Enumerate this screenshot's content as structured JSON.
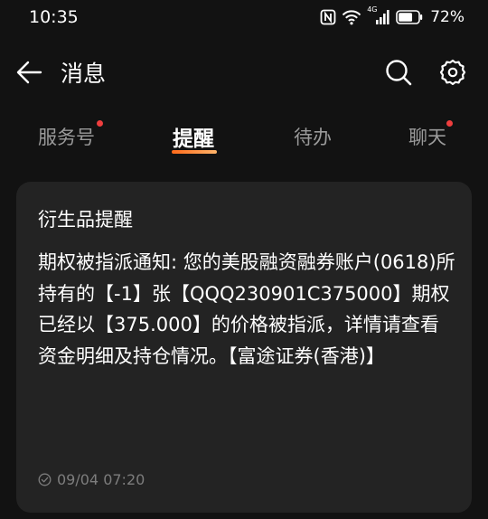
{
  "status_bar": {
    "time": "10:35",
    "network_label": "4G",
    "battery": "72%",
    "battery_level": 0.72
  },
  "header": {
    "title": "消息",
    "back_icon": "arrow-left-icon",
    "search_icon": "search-icon",
    "settings_icon": "gear-icon"
  },
  "tabs": [
    {
      "label": "服务号",
      "badge": true,
      "active": false
    },
    {
      "label": "提醒",
      "badge": false,
      "active": true
    },
    {
      "label": "待办",
      "badge": false,
      "active": false
    },
    {
      "label": "聊天",
      "badge": true,
      "active": false
    }
  ],
  "card": {
    "title": "衍生品提醒",
    "body": "期权被指派通知: 您的美股融资融券账户(0618)所持有的【-1】张【QQQ230901C375000】期权已经以【375.000】的价格被指派，详情请查看资金明细及持仓情况。【富途证券(香港)】",
    "timestamp": "09/04 07:20"
  },
  "colors": {
    "background": "#121212",
    "card": "#232323",
    "badge": "#ef3e3e",
    "tab_indicator": "#ff6a1a",
    "inactive_tab": "#9a9a9a",
    "muted_text": "#7d7d7d"
  }
}
